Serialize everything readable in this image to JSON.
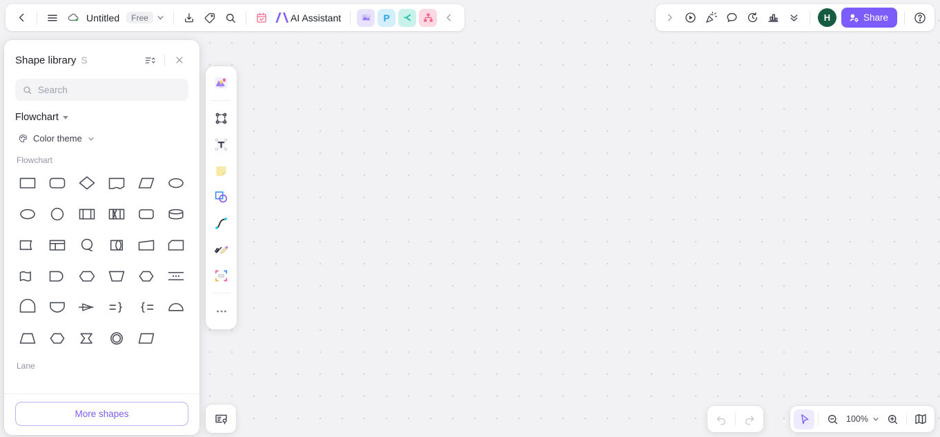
{
  "app": {
    "document_title": "Untitled",
    "plan_badge": "Free"
  },
  "topbar_left": {
    "items": [
      {
        "name": "back-icon",
        "label": "Back"
      },
      {
        "name": "menu-icon",
        "label": "Menu"
      },
      {
        "name": "cloud-saved-icon",
        "label": "Saved to cloud"
      },
      {
        "name": "title-dropdown-caret-icon",
        "label": "Document options"
      },
      {
        "name": "download-icon",
        "label": "Export"
      },
      {
        "name": "tag-icon",
        "label": "Tags"
      },
      {
        "name": "search-icon",
        "label": "Search"
      },
      {
        "name": "calendar-icon",
        "label": "Calendar"
      }
    ],
    "ai_assistant_label": "AI Assistant",
    "app_icons": [
      {
        "name": "image-app-icon",
        "glyph": "",
        "bg": "#e8e2fd",
        "fg": "#9d85f5"
      },
      {
        "name": "presentation-app-icon",
        "glyph": "P",
        "bg": "#d5eefb",
        "fg": "#2aa5e8"
      },
      {
        "name": "chart-app-icon",
        "glyph": "",
        "bg": "#c9f2ea",
        "fg": "#25c2a8"
      },
      {
        "name": "mindmap-app-icon",
        "glyph": "",
        "bg": "#fcd9e2",
        "fg": "#f4618c"
      }
    ],
    "collapse_label": "Collapse"
  },
  "topbar_right": {
    "expand_label": "Expand",
    "items": [
      {
        "name": "present-icon",
        "label": "Present"
      },
      {
        "name": "celebrate-icon",
        "label": "Celebrate"
      },
      {
        "name": "comment-icon",
        "label": "Comment"
      },
      {
        "name": "history-icon",
        "label": "Version history"
      },
      {
        "name": "analytics-icon",
        "label": "Analytics"
      },
      {
        "name": "chevron-double-down-icon",
        "label": "More"
      }
    ],
    "avatar_initial": "H",
    "share_label": "Share",
    "help_label": "Help"
  },
  "shape_panel": {
    "title": "Shape library",
    "shortcut_key": "S",
    "sort_label": "Sort",
    "close_label": "Close",
    "search": {
      "value": "",
      "placeholder": "Search"
    },
    "category": "Flowchart",
    "color_theme_label": "Color theme",
    "sections": [
      {
        "label": "Flowchart",
        "shapes": [
          {
            "name": "shape-rectangle",
            "type": "rect"
          },
          {
            "name": "shape-rounded-rectangle",
            "type": "rounded"
          },
          {
            "name": "shape-diamond",
            "type": "diamond"
          },
          {
            "name": "shape-document",
            "type": "document"
          },
          {
            "name": "shape-parallelogram",
            "type": "parallelogram"
          },
          {
            "name": "shape-ellipse-wide",
            "type": "ellipse-wide"
          },
          {
            "name": "shape-ellipse",
            "type": "ellipse"
          },
          {
            "name": "shape-circle",
            "type": "circle"
          },
          {
            "name": "shape-predefined-process",
            "type": "predefined-process"
          },
          {
            "name": "shape-internal-storage",
            "type": "internal-storage"
          },
          {
            "name": "shape-stadium",
            "type": "stadium"
          },
          {
            "name": "shape-database",
            "type": "database"
          },
          {
            "name": "shape-tape",
            "type": "tape"
          },
          {
            "name": "shape-window",
            "type": "window"
          },
          {
            "name": "shape-loop-limit",
            "type": "loop-circle"
          },
          {
            "name": "shape-direct-access-storage",
            "type": "direct-access"
          },
          {
            "name": "shape-trapezoid-right",
            "type": "trapezoid-right"
          },
          {
            "name": "shape-card",
            "type": "card"
          },
          {
            "name": "shape-wave-document",
            "type": "wave-document"
          },
          {
            "name": "shape-delay",
            "type": "delay"
          },
          {
            "name": "shape-hexagon-round",
            "type": "hexagon-round"
          },
          {
            "name": "shape-manual-operation",
            "type": "manual-operation"
          },
          {
            "name": "shape-preparation",
            "type": "preparation"
          },
          {
            "name": "shape-stored-data-lines",
            "type": "lines-dots"
          },
          {
            "name": "shape-arch",
            "type": "arch"
          },
          {
            "name": "shape-shield",
            "type": "shield"
          },
          {
            "name": "shape-merge-arrow",
            "type": "merge-arrow"
          },
          {
            "name": "shape-brace-right",
            "type": "brace-right"
          },
          {
            "name": "shape-brace-left",
            "type": "brace-left"
          },
          {
            "name": "shape-half-circle",
            "type": "half-circle"
          },
          {
            "name": "shape-trapezoid",
            "type": "trapezoid"
          },
          {
            "name": "shape-hexagon",
            "type": "hexagon"
          },
          {
            "name": "shape-summing-junction",
            "type": "sigma-flag"
          },
          {
            "name": "shape-double-circle",
            "type": "double-circle"
          },
          {
            "name": "shape-parallelogram-right",
            "type": "parallelogram-right"
          }
        ]
      },
      {
        "label": "Lane",
        "shapes": []
      }
    ],
    "more_shapes_label": "More shapes"
  },
  "tool_rail": {
    "items": [
      {
        "name": "templates-icon",
        "label": "Templates"
      },
      {
        "name": "frame-icon",
        "label": "Frame"
      },
      {
        "name": "text-icon",
        "label": "Text"
      },
      {
        "name": "sticky-note-icon",
        "label": "Sticky note"
      },
      {
        "name": "shapes-icon",
        "label": "Shapes"
      },
      {
        "name": "connector-icon",
        "label": "Connector"
      },
      {
        "name": "pen-icon",
        "label": "Pen"
      },
      {
        "name": "mind-map-icon",
        "label": "Mind map"
      },
      {
        "name": "more-tools-icon",
        "label": "More tools"
      }
    ]
  },
  "bottom": {
    "notes_label": "Notes",
    "undo_label": "Undo",
    "redo_label": "Redo",
    "select_label": "Select",
    "zoom_out_label": "Zoom out",
    "zoom_level": "100%",
    "zoom_in_label": "Zoom in",
    "minimap_label": "Minimap"
  },
  "colors": {
    "accent": "#7c5cfa",
    "avatar_bg": "#165c42",
    "canvas_bg": "#f2f2f4",
    "shape_stroke": "#484b55"
  }
}
